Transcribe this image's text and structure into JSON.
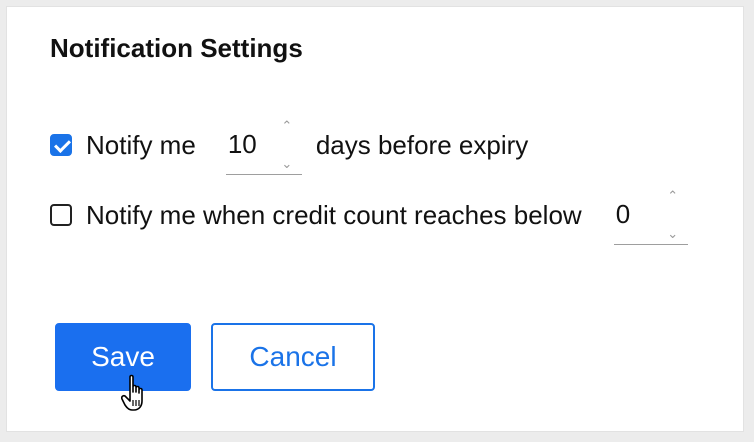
{
  "heading": "Notification Settings",
  "expiry_rule": {
    "checked": true,
    "prefix": "Notify me",
    "value": "10",
    "suffix": "days before expiry"
  },
  "credit_rule": {
    "checked": false,
    "label": "Notify me when credit count reaches below",
    "value": "0"
  },
  "buttons": {
    "save": "Save",
    "cancel": "Cancel"
  },
  "icons": {
    "stepper_up": "chevron-up-icon",
    "stepper_down": "chevron-down-icon",
    "cursor": "hand-pointer-icon"
  },
  "colors": {
    "accent": "#1a73e8",
    "save_bg": "#1a6fef"
  }
}
